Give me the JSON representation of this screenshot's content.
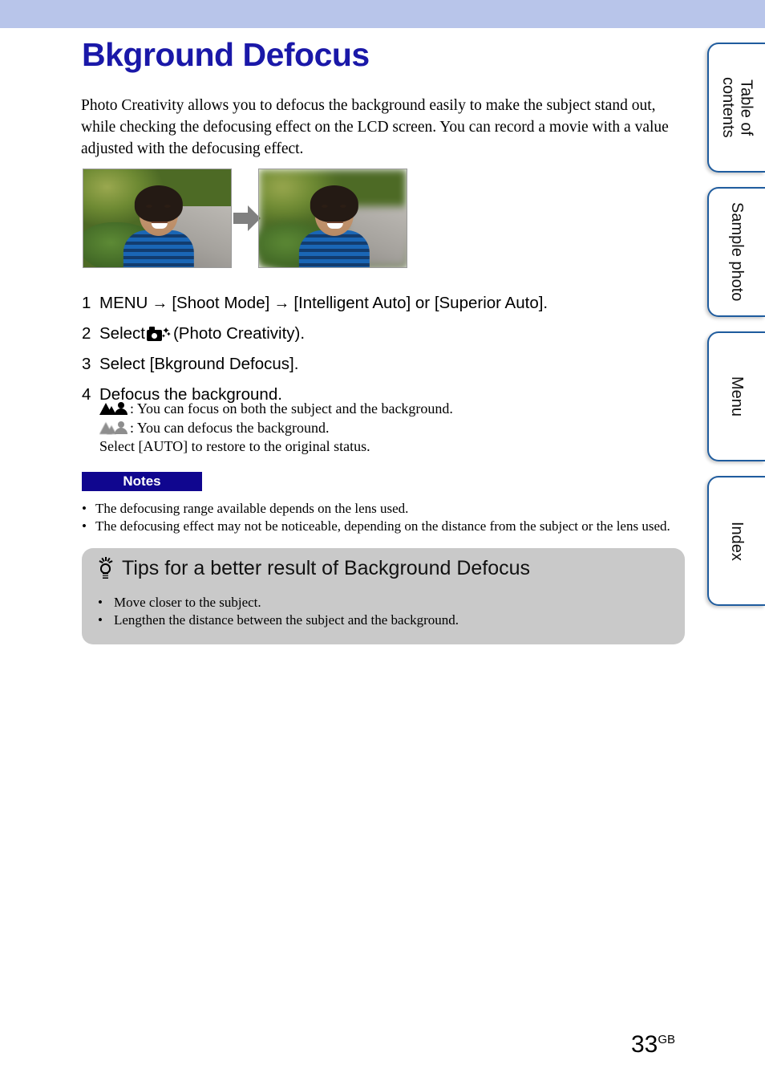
{
  "page": {
    "title": "Bkground Defocus",
    "number": "33",
    "number_suffix": "GB",
    "title_color": "#1a18a8",
    "banner_color": "#b8c5ea"
  },
  "intro": "Photo Creativity allows you to defocus the background easily to make the subject stand out, while checking the defocusing effect on the LCD screen. You can record a movie with a value adjusted with the defocusing effect.",
  "illustration": {
    "before_alt": "Photo of a boy with the background in focus",
    "after_alt": "Photo of a boy with the background defocused",
    "arrow": "right-arrow"
  },
  "steps": [
    {
      "num": "1",
      "parts": [
        "MENU",
        "[Shoot Mode]",
        "[Intelligent Auto] or [Superior Auto]."
      ],
      "separator": "→",
      "icon": ""
    },
    {
      "num": "2",
      "parts": [
        "Select",
        "(Photo Creativity)."
      ],
      "separator": "",
      "icon": "photo-creativity-icon"
    },
    {
      "num": "3",
      "parts": [
        "Select [Bkground Defocus]."
      ],
      "separator": "",
      "icon": ""
    },
    {
      "num": "4",
      "parts": [
        "Defocus the background."
      ],
      "separator": "",
      "icon": ""
    }
  ],
  "substeps": {
    "line1_icon": "mountain-person-sharp-icon",
    "line1": ": You can focus on both the subject and the background.",
    "line2_icon": "mountain-person-blurred-icon",
    "line2": ": You can defocus the background.",
    "line3": "Select [AUTO] to restore to the original status."
  },
  "notes": {
    "label": "Notes",
    "badge_bg": "#10068f",
    "badge_text_color": "#ffffff",
    "items": [
      "The defocusing range available depends on the lens used.",
      "The defocusing effect may not be noticeable, depending on the distance from the subject or the lens used."
    ],
    "bullet": "•"
  },
  "tips": {
    "icon": "lightbulb-icon",
    "heading": "Tips for a better result of Background Defocus",
    "bg_color": "#c9c9c9",
    "items": [
      "Move closer to the subject.",
      "Lengthen the distance between the subject and the background."
    ],
    "bullet": "•"
  },
  "tabs": [
    {
      "label": "Table of\ncontents"
    },
    {
      "label": "Sample photo"
    },
    {
      "label": "Menu"
    },
    {
      "label": "Index"
    }
  ]
}
